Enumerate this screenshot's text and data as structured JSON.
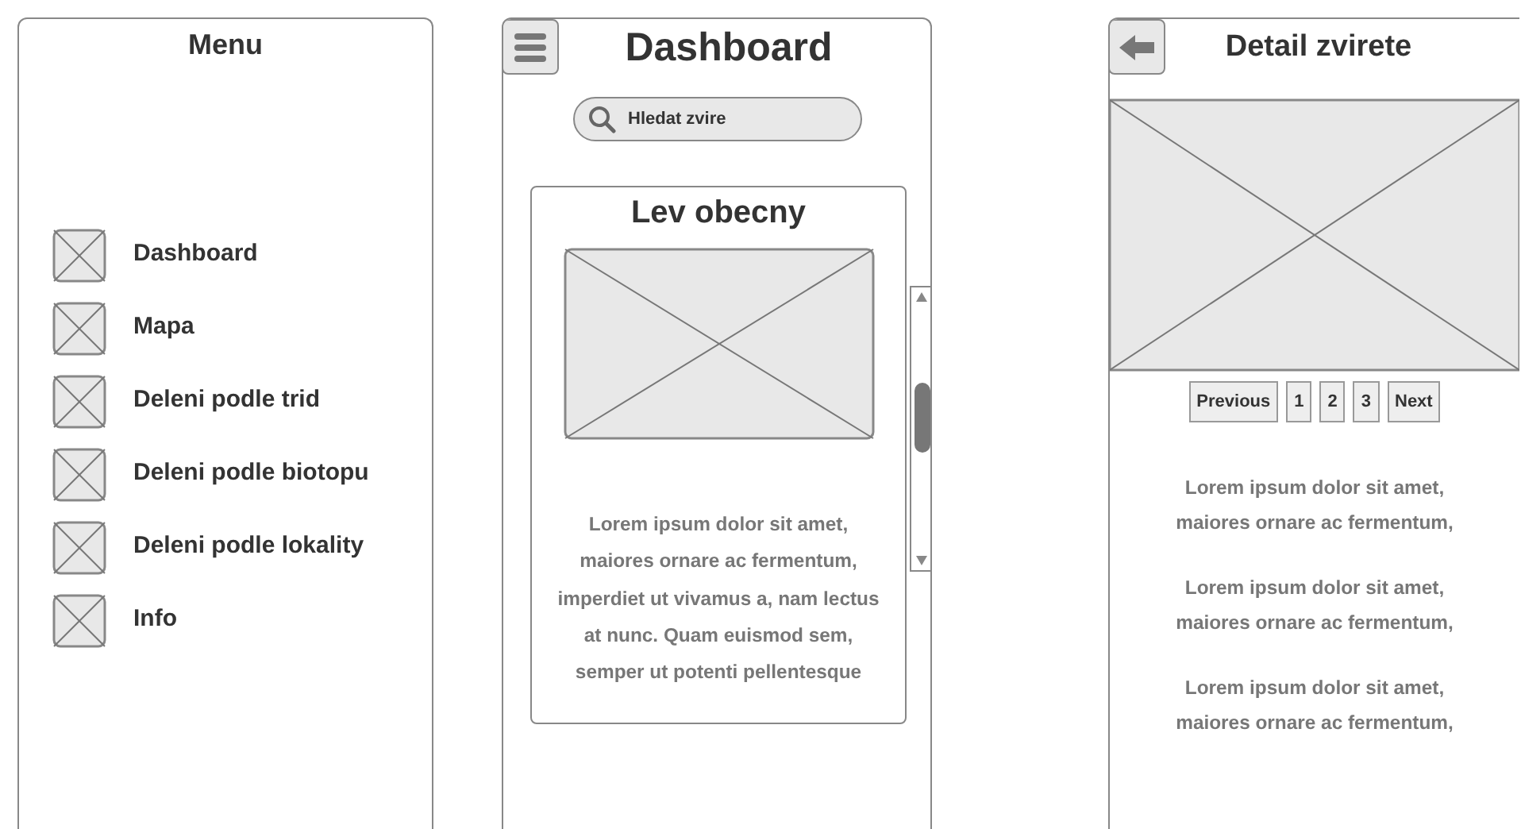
{
  "menu_screen": {
    "title": "Menu",
    "items": [
      {
        "label": "Dashboard"
      },
      {
        "label": "Mapa"
      },
      {
        "label": "Deleni podle trid"
      },
      {
        "label": "Deleni podle biotopu"
      },
      {
        "label": "Deleni podle lokality"
      },
      {
        "label": "Info"
      }
    ]
  },
  "dashboard_screen": {
    "title": "Dashboard",
    "search": {
      "placeholder": "Hledat zvire"
    },
    "card": {
      "title": "Lev obecny",
      "text_lines": [
        "Lorem ipsum dolor sit amet,",
        "maiores ornare ac fermentum,",
        "imperdiet ut vivamus a, nam lectus",
        "at nunc. Quam euismod sem,",
        "semper ut potenti pellentesque"
      ]
    }
  },
  "detail_screen": {
    "title": "Detail zvirete",
    "pagination": [
      "Previous",
      "1",
      "2",
      "3",
      "Next"
    ],
    "paragraphs": [
      [
        "Lorem ipsum dolor sit amet,",
        "maiores ornare ac fermentum,"
      ],
      [
        "Lorem ipsum dolor sit amet,",
        "maiores ornare ac fermentum,"
      ],
      [
        "Lorem ipsum dolor sit amet,",
        "maiores ornare ac fermentum,"
      ]
    ]
  }
}
